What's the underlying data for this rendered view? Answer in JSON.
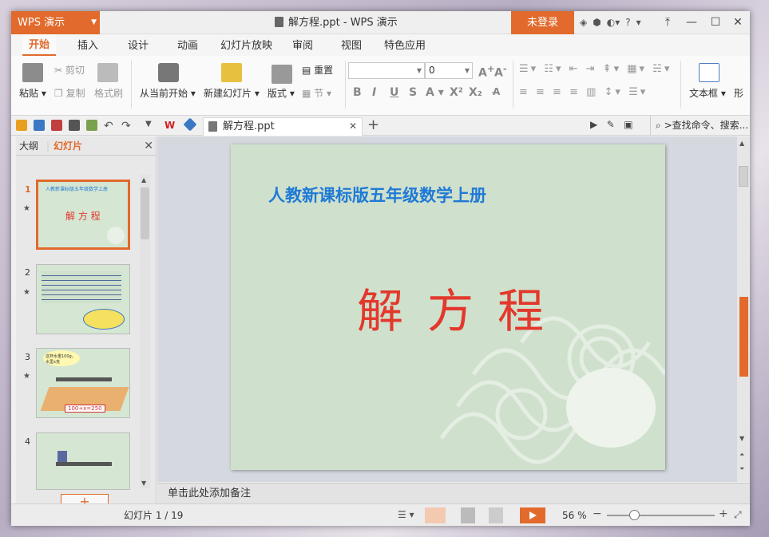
{
  "titlebar": {
    "app_label": "WPS 演示",
    "document_title": "解方程.ppt - WPS 演示",
    "login_label": "未登录",
    "help_label": "?"
  },
  "ribbon_tabs": [
    "开始",
    "插入",
    "设计",
    "动画",
    "幻灯片放映",
    "审阅",
    "视图",
    "特色应用"
  ],
  "ribbon": {
    "paste": "粘贴",
    "cut": "剪切",
    "copy": "复制",
    "format_painter": "格式刷",
    "from_current": "从当前开始",
    "new_slide": "新建幻灯片",
    "layout": "版式",
    "reset": "重置",
    "section": "节",
    "font_size": "0",
    "textbox": "文本框",
    "shape": "形"
  },
  "quickbar": {
    "doc_tab": "解方程.ppt",
    "search": ">查找命令、搜索..."
  },
  "left_panel": {
    "tab_outline": "大纲",
    "tab_slides": "幻灯片",
    "thumbnails": [
      {
        "num": "1",
        "subtitle": "人教新课标版五年级数学上册",
        "title": "解 方 程"
      },
      {
        "num": "2"
      },
      {
        "num": "3",
        "bubble": "这杯水重100g。水里x克",
        "eq": "100+x=250"
      },
      {
        "num": "4"
      }
    ]
  },
  "slide": {
    "subtitle": "人教新课标版五年级数学上册",
    "title": "解方程"
  },
  "notes_placeholder": "单击此处添加备注",
  "status": {
    "slide_count": "幻灯片 1 / 19",
    "zoom": "56 %"
  },
  "colors": {
    "accent": "#e26a2c",
    "slide_bg": "#cfe0cc",
    "title_red": "#e3382c",
    "subtitle_blue": "#1f7ad6"
  }
}
